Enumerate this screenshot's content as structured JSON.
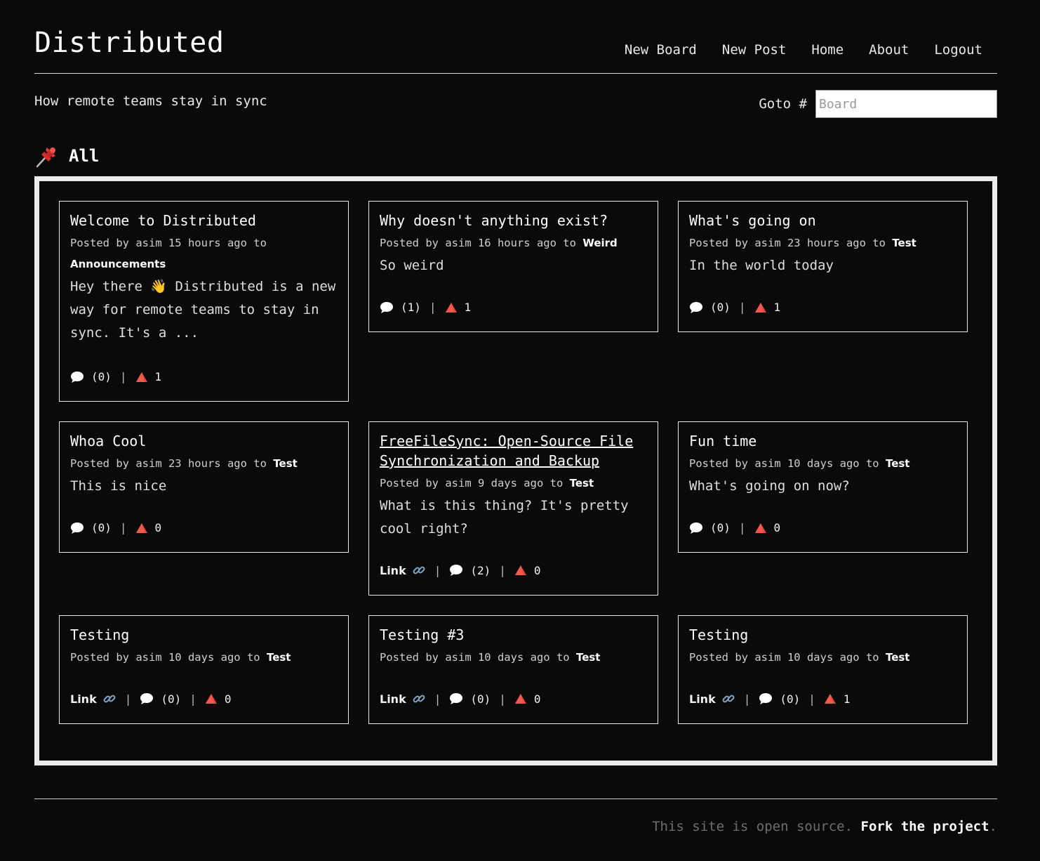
{
  "site": {
    "title": "Distributed",
    "tagline": "How remote teams stay in sync"
  },
  "nav": {
    "items": [
      {
        "label": "New Board"
      },
      {
        "label": "New Post"
      },
      {
        "label": "Home"
      },
      {
        "label": "About"
      },
      {
        "label": "Logout"
      }
    ]
  },
  "goto": {
    "label": "Goto #",
    "placeholder": "Board",
    "value": ""
  },
  "section": {
    "icon": "pushpin-icon",
    "title": "All"
  },
  "posts": [
    {
      "title": "Welcome to Distributed",
      "meta_prefix": "Posted by asim 15 hours ago to",
      "board": "Announcements",
      "body": "Hey there 👋 Distributed is a new way for remote teams to stay in sync. It's a ...",
      "has_link": false,
      "comments": "(0)",
      "votes": "1"
    },
    {
      "title": "Why doesn't anything exist?",
      "meta_prefix": "Posted by asim 16 hours ago to",
      "board": "Weird",
      "body": "So weird",
      "has_link": false,
      "comments": "(1)",
      "votes": "1"
    },
    {
      "title": "What's going on",
      "meta_prefix": "Posted by asim 23 hours ago to",
      "board": "Test",
      "body": "In the world today",
      "has_link": false,
      "comments": "(0)",
      "votes": "1"
    },
    {
      "title": "Whoa Cool",
      "meta_prefix": "Posted by asim 23 hours ago to",
      "board": "Test",
      "body": "This is nice",
      "has_link": false,
      "comments": "(0)",
      "votes": "0"
    },
    {
      "title": "FreeFileSync: Open-Source File Synchronization and Backup",
      "meta_prefix": "Posted by asim 9 days ago to",
      "board": "Test",
      "body": "What is this thing? It's pretty cool right?",
      "has_link": true,
      "link_label": "Link",
      "comments": "(2)",
      "votes": "0"
    },
    {
      "title": "Fun time",
      "meta_prefix": "Posted by asim 10 days ago to",
      "board": "Test",
      "body": "What's going on now?",
      "has_link": false,
      "comments": "(0)",
      "votes": "0"
    },
    {
      "title": "Testing",
      "meta_prefix": "Posted by asim 10 days ago to",
      "board": "Test",
      "body": "",
      "has_link": true,
      "link_label": "Link",
      "comments": "(0)",
      "votes": "0"
    },
    {
      "title": "Testing #3",
      "meta_prefix": "Posted by asim 10 days ago to",
      "board": "Test",
      "body": "",
      "has_link": true,
      "link_label": "Link",
      "comments": "(0)",
      "votes": "0"
    },
    {
      "title": "Testing",
      "meta_prefix": "Posted by asim 10 days ago to",
      "board": "Test",
      "body": "",
      "has_link": true,
      "link_label": "Link",
      "comments": "(0)",
      "votes": "1"
    }
  ],
  "footer": {
    "text": "This site is open source.",
    "link_label": "Fork the project",
    "suffix": "."
  },
  "colors": {
    "background": "#0a0a0a",
    "text": "#f0f0f0",
    "upvote": "#e8473c",
    "link_icon": "#7fa8c9"
  }
}
